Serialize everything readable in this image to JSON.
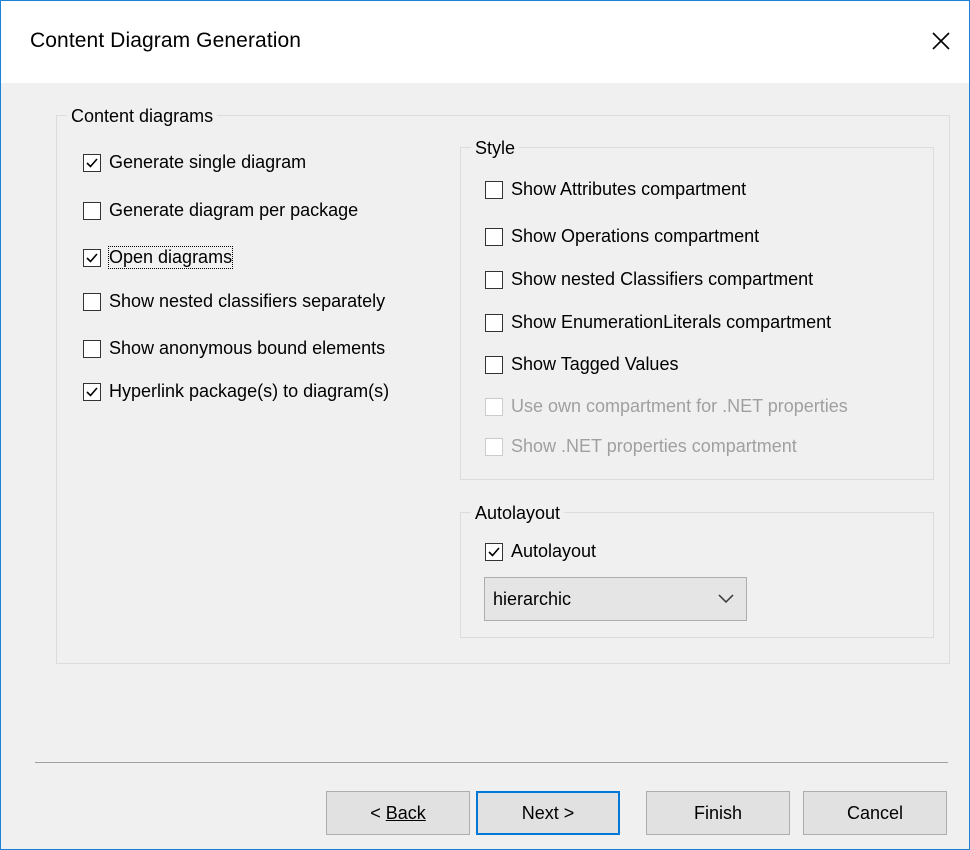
{
  "dialog": {
    "title": "Content Diagram Generation"
  },
  "content_group": {
    "label": "Content diagrams",
    "items": [
      {
        "label": "Generate single diagram",
        "checked": true
      },
      {
        "label": "Generate diagram per package",
        "checked": false
      },
      {
        "label": "Open diagrams",
        "checked": true
      },
      {
        "label": "Show nested classifiers separately",
        "checked": false
      },
      {
        "label": "Show anonymous bound elements",
        "checked": false
      },
      {
        "label": "Hyperlink package(s) to diagram(s)",
        "checked": true
      }
    ]
  },
  "style_group": {
    "label": "Style",
    "items": [
      {
        "label": "Show Attributes compartment",
        "checked": false,
        "enabled": true
      },
      {
        "label": "Show Operations compartment",
        "checked": false,
        "enabled": true
      },
      {
        "label": "Show nested Classifiers compartment",
        "checked": false,
        "enabled": true
      },
      {
        "label": "Show EnumerationLiterals compartment",
        "checked": false,
        "enabled": true
      },
      {
        "label": "Show Tagged Values",
        "checked": false,
        "enabled": true
      },
      {
        "label": "Use own compartment for .NET properties",
        "checked": false,
        "enabled": false
      },
      {
        "label": "Show .NET properties compartment",
        "checked": false,
        "enabled": false
      }
    ]
  },
  "autolayout_group": {
    "label": "Autolayout",
    "checkbox": {
      "label": "Autolayout",
      "checked": true
    },
    "select_value": "hierarchic"
  },
  "buttons": {
    "back": "Back",
    "next": "Next >",
    "finish": "Finish",
    "cancel": "Cancel"
  },
  "icons": {
    "close": "close-icon",
    "check": "checkmark-icon",
    "dropdown": "chevron-down-icon"
  },
  "colors": {
    "accent": "#0078d7",
    "window_border": "#1883d7",
    "disabled_text": "#a0a0a0"
  }
}
